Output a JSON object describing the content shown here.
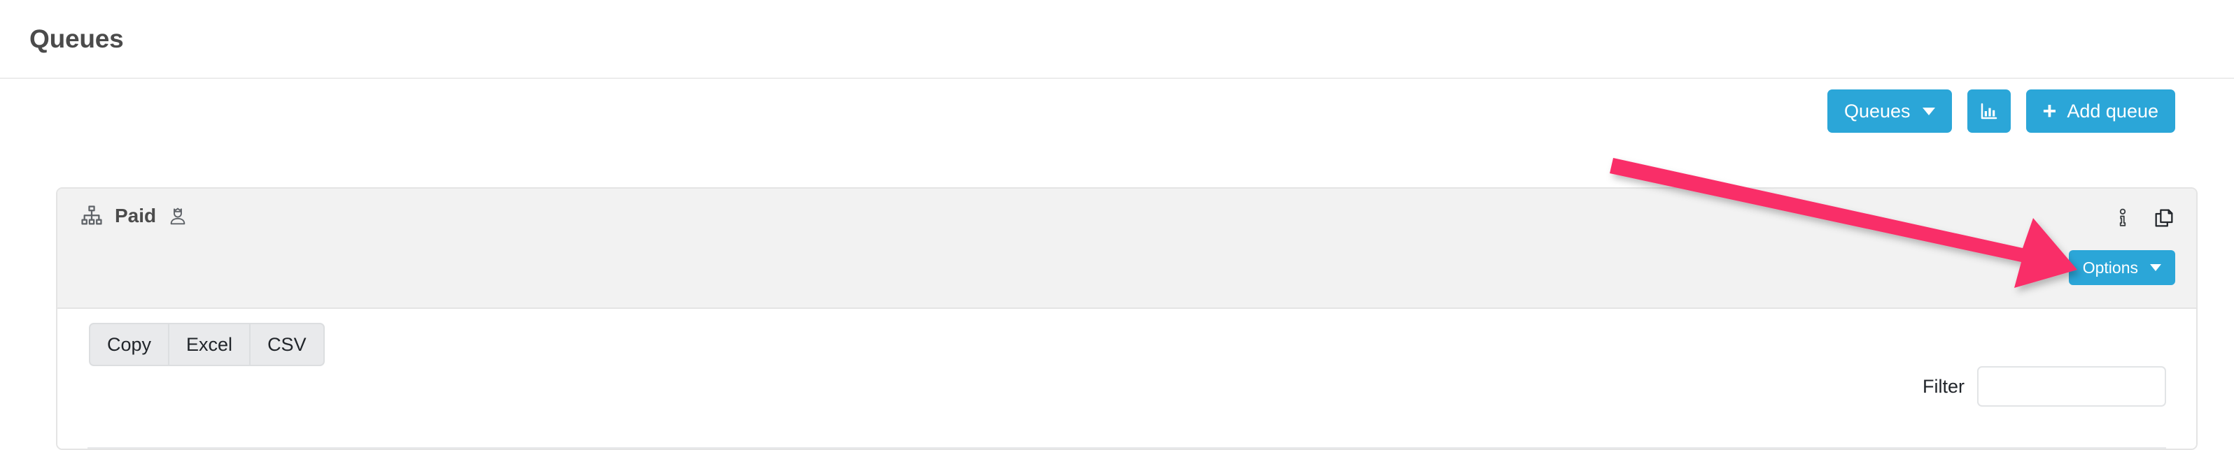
{
  "page": {
    "title": "Queues"
  },
  "toolbar": {
    "queues_dropdown_label": "Queues",
    "chart_button_icon": "bar-chart-icon",
    "add_queue_label": "Add queue",
    "add_queue_plus": "+",
    "accent_color": "#2ba6d8"
  },
  "card": {
    "hierarchy_icon": "sitemap-icon",
    "title": "Paid",
    "premium_icon": "user-crown-icon",
    "info_icon": "info-icon",
    "copy_icon": "copy-icon",
    "options_label": "Options",
    "header_background": "#f2f2f2"
  },
  "export": {
    "buttons": [
      {
        "label": "Copy"
      },
      {
        "label": "Excel"
      },
      {
        "label": "CSV"
      }
    ]
  },
  "filter": {
    "label": "Filter",
    "value": "",
    "placeholder": ""
  },
  "annotation": {
    "type": "arrow",
    "color": "#f92f68",
    "points_to": "options-button"
  }
}
